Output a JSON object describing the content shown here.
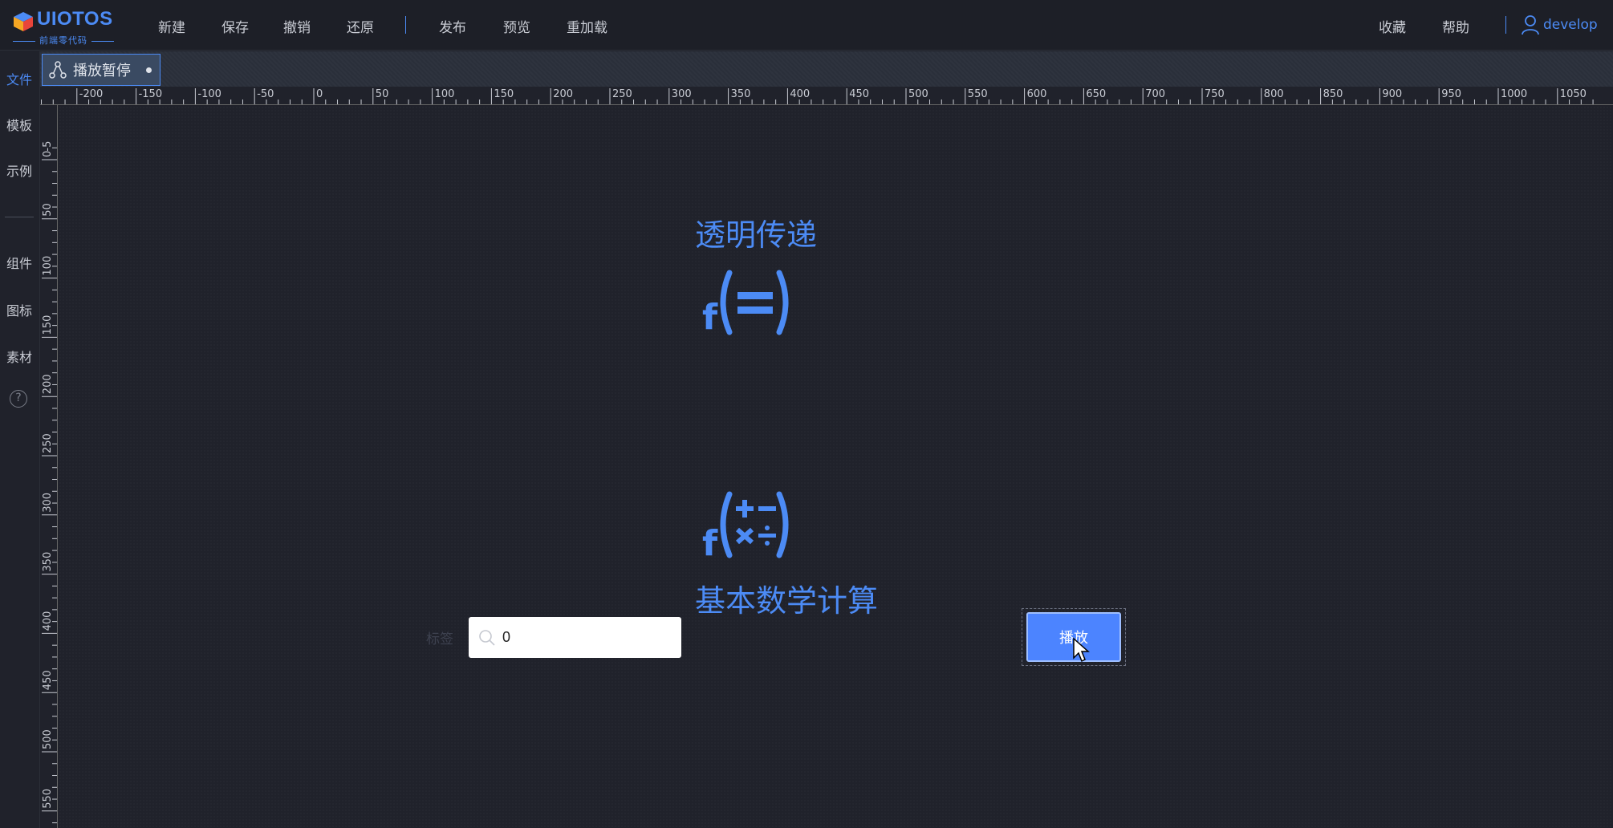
{
  "app": {
    "brand": "UIOTOS",
    "slogan": "前端零代码"
  },
  "menu": {
    "new": "新建",
    "save": "保存",
    "undo": "撤销",
    "redo": "还原",
    "publish": "发布",
    "preview": "预览",
    "reload": "重加载",
    "favorites": "收藏",
    "help": "帮助",
    "username": "develop"
  },
  "sidebar": {
    "items": [
      {
        "label": "文件",
        "active": true
      },
      {
        "label": "模板"
      },
      {
        "label": "示例"
      },
      {
        "label": "组件"
      },
      {
        "label": "图标"
      },
      {
        "label": "素材"
      }
    ],
    "help": "?"
  },
  "tab": {
    "label": "播放暂停"
  },
  "ruler": {
    "h_labels": [
      "-200",
      "-150",
      "-100",
      "-50",
      "0",
      "50",
      "100",
      "150",
      "200",
      "250",
      "300",
      "350",
      "400",
      "450",
      "500",
      "550",
      "600",
      "650",
      "700",
      "750",
      "800",
      "850",
      "900",
      "950",
      "1000",
      "1050"
    ],
    "v_labels": [
      "-5",
      "0",
      "50",
      "100",
      "150",
      "200",
      "250",
      "300",
      "350",
      "400",
      "450",
      "500",
      "550"
    ]
  },
  "canvas": {
    "func_transparent_title": "透明传递",
    "func_math_title": "基本数学计算",
    "input_label": "标签",
    "input_value": "0",
    "play_button": "播放"
  },
  "colors": {
    "accent": "#4c8bf5",
    "button": "#4c84ff",
    "background": "#20222b"
  }
}
